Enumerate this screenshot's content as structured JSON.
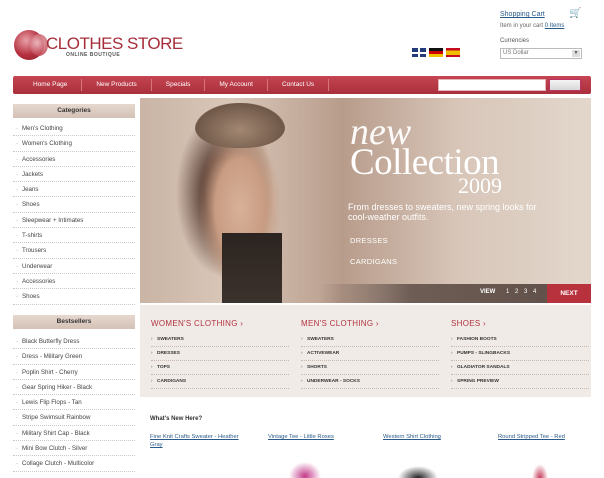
{
  "header": {
    "logo_title": "CLOTHES STORE",
    "logo_subtitle": "ONLINE BOUTIQUE",
    "cart_link": "Shopping Cart",
    "cart_note_prefix": "Item in your cart",
    "cart_note_count": "0 Items",
    "currencies_label": "Currencies",
    "currency_selected": "US Dollar",
    "flags": [
      "uk-flag-icon",
      "germany-flag-icon",
      "spain-flag-icon"
    ]
  },
  "nav": {
    "items": [
      "Home Page",
      "New Products",
      "Specials",
      "My Account",
      "Contact Us"
    ]
  },
  "sidebar": {
    "categories_title": "Categories",
    "categories": [
      "Men's Clothing",
      "Women's Clothing",
      "Accessories",
      "Jackets",
      "Jeans",
      "Shoes",
      "Sleepwear + Intimates",
      "T-shirts",
      "Trousers",
      "Underwear",
      "Accessories",
      "Shoes"
    ],
    "bestsellers_title": "Bestsellers",
    "bestsellers": [
      "Black Butterfly Dress",
      "Dress - Military Green",
      "Poplin Shirt - Cherry",
      "Gear Spring Hiker - Black",
      "Lewis Flip Flops - Tan",
      "Stripe Swimsuit Rainbow",
      "Military Shirt Cap - Black",
      "Mini Bow Clutch - Silver",
      "Collage Clutch - Multicolor"
    ]
  },
  "banner": {
    "line1": "new",
    "line2": "Collection",
    "year": "2009",
    "subtitle": "From dresses to sweaters, new spring looks for cool-weather outfits.",
    "link1": "DRESSES",
    "link2": "CARDIGANS",
    "view_label": "VIEW",
    "pages": "1 2 3 4",
    "next_label": "NEXT"
  },
  "categories_block": [
    {
      "title": "WOMEN'S CLOTHING ›",
      "links": [
        "SWEATERS",
        "DRESSES",
        "TOPS",
        "CARDIGANS"
      ]
    },
    {
      "title": "MEN'S CLOTHING ›",
      "links": [
        "SWEATERS",
        "ACTIVEWEAR",
        "SHORTS",
        "UNDERWEAR - SOCKS"
      ]
    },
    {
      "title": "SHOES ›",
      "links": [
        "FASHION BOOTS",
        "PUMPS - SLINGBACKS",
        "GLADIATOR SANDALS",
        "SPRING PREVIEW"
      ]
    }
  ],
  "whats_new": {
    "title": "What's New Here?",
    "products": [
      "Fine Knit Crafts Sweater - Heather Gray",
      "Vintage Tee - Little Roses",
      "Western Shirt Clothing",
      "Round Stripped Tee - Red"
    ]
  },
  "colors": {
    "accent": "#b13440",
    "nav_bg": "#b8323e",
    "sidebar_head": "#dccbc0",
    "link": "#2a5a8a"
  }
}
